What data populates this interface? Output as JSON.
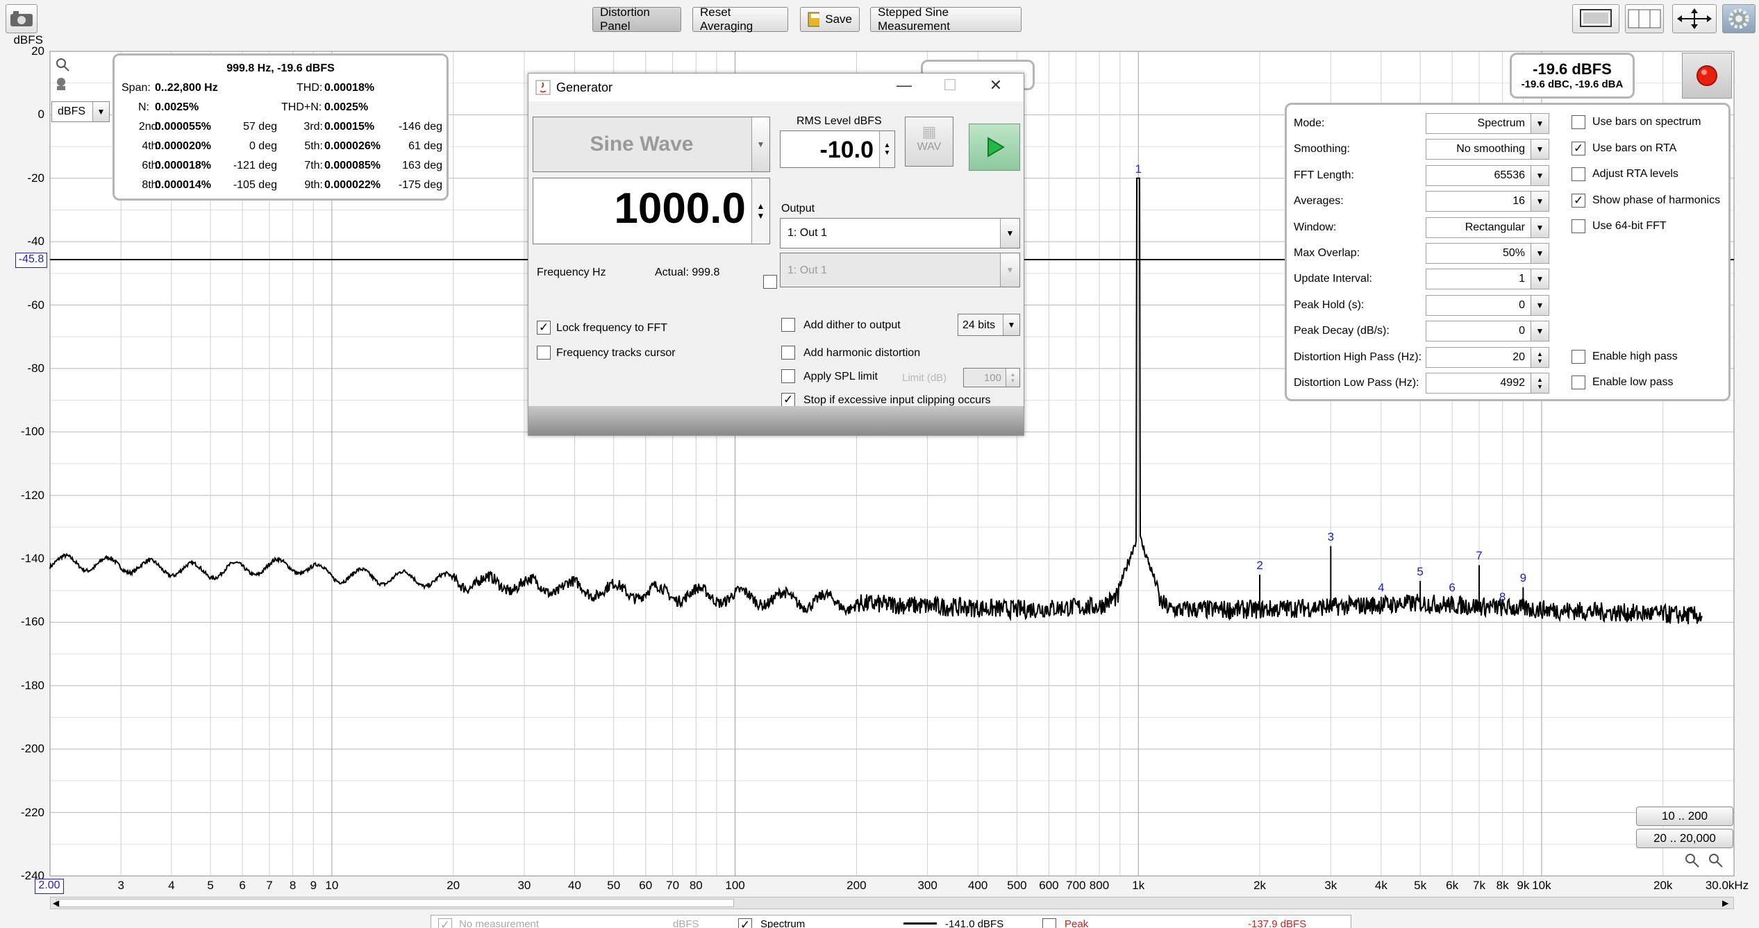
{
  "toolbar": {
    "distortion_panel": "Distortion Panel",
    "reset_averaging": "Reset Averaging",
    "save": "Save",
    "stepped_sine": "Stepped Sine Measurement"
  },
  "plot": {
    "y_unit": "dBFS",
    "y_ticks": [
      "20",
      "0",
      "-20",
      "-40",
      "-60",
      "-80",
      "-100",
      "-120",
      "-140",
      "-160",
      "-180",
      "-200",
      "-220",
      "-240"
    ],
    "x_ticks": [
      "2.00",
      "3",
      "4",
      "5",
      "6",
      "7",
      "8",
      "9",
      "10",
      "20",
      "30",
      "40",
      "50",
      "60",
      "70",
      "80",
      "100",
      "200",
      "300",
      "400",
      "500",
      "600",
      "700",
      "800",
      "1k",
      "2k",
      "3k",
      "4k",
      "5k",
      "6k",
      "7k",
      "8k",
      "9k",
      "10k",
      "20k",
      "30.0kHz"
    ],
    "cursor_level": "-45.8",
    "unit_select": "dBFS",
    "harmonic_labels": [
      "1",
      "2",
      "3",
      "4",
      "5",
      "6",
      "7",
      "8",
      "9"
    ]
  },
  "chart_data": {
    "type": "line",
    "title": "",
    "xlabel": "",
    "ylabel": "dBFS",
    "xscale": "log",
    "xlim": [
      2,
      30000
    ],
    "ylim": [
      -240,
      20
    ],
    "grid": true,
    "series": [
      {
        "name": "Spectrum",
        "x": [
          2,
          3,
          5,
          8,
          10,
          20,
          50,
          100,
          200,
          500,
          800,
          950,
          1000,
          1050,
          1200,
          2000,
          5000,
          10000,
          25000
        ],
        "y": [
          -141,
          -142,
          -144,
          -142,
          -145,
          -147,
          -150,
          -152,
          -154,
          -156,
          -155,
          -150,
          -20,
          -150,
          -156,
          -156,
          -154,
          -156,
          -158
        ]
      }
    ],
    "peaks": [
      {
        "label": "1",
        "x": 1000,
        "y": -20
      },
      {
        "label": "2",
        "x": 2000,
        "y": -145
      },
      {
        "label": "3",
        "x": 3000,
        "y": -136
      },
      {
        "label": "4",
        "x": 4000,
        "y": -152
      },
      {
        "label": "5",
        "x": 5000,
        "y": -147
      },
      {
        "label": "6",
        "x": 6000,
        "y": -152
      },
      {
        "label": "7",
        "x": 7000,
        "y": -142
      },
      {
        "label": "8",
        "x": 8000,
        "y": -155
      },
      {
        "label": "9",
        "x": 9000,
        "y": -149
      }
    ]
  },
  "distortion": {
    "header": "999.8 Hz, -19.6 dBFS",
    "span_label": "Span:",
    "span_value": "0..22,800 Hz",
    "thd_label": "THD:",
    "thd_value": "0.00018%",
    "n_label": "N:",
    "n_value": "0.0025%",
    "thdn_label": "THD+N:",
    "thdn_value": "0.0025%",
    "harmonics": [
      {
        "l1": "2nd:",
        "v1": "0.000055%",
        "p1": "57 deg",
        "l2": "3rd:",
        "v2": "0.00015%",
        "p2": "-146 deg"
      },
      {
        "l1": "4th:",
        "v1": "0.000020%",
        "p1": "0 deg",
        "l2": "5th:",
        "v2": "0.000026%",
        "p2": "61 deg"
      },
      {
        "l1": "6th:",
        "v1": "0.000018%",
        "p1": "-121 deg",
        "l2": "7th:",
        "v2": "0.000085%",
        "p2": "163 deg"
      },
      {
        "l1": "8th:",
        "v1": "0.000014%",
        "p1": "-105 deg",
        "l2": "9th:",
        "v2": "0.000022%",
        "p2": "-175 deg"
      }
    ]
  },
  "level_box": {
    "main": "-19.6 dBFS",
    "sub": "-19.6 dBC, -19.6 dBA"
  },
  "generator": {
    "title": "Generator",
    "signal_type": "Sine Wave",
    "rms_label": "RMS Level dBFS",
    "rms_value": "-10.0",
    "wav_label": "WAV",
    "frequency": "1000.0",
    "freq_label": "Frequency Hz",
    "actual": "Actual: 999.8",
    "output_label": "Output",
    "output_1": "1: Out 1",
    "output_2": "1: Out 1",
    "lock_freq": "Lock frequency to FFT",
    "freq_tracks": "Frequency tracks cursor",
    "add_dither": "Add dither to output",
    "bits": "24 bits",
    "add_harm": "Add harmonic distortion",
    "apply_spl": "Apply SPL limit",
    "limit_label": "Limit (dB)",
    "limit_value": "100",
    "stop_clip": "Stop if excessive input clipping occurs"
  },
  "settings": {
    "rows": [
      {
        "label": "Mode:",
        "value": "Spectrum"
      },
      {
        "label": "Smoothing:",
        "value": "No  smoothing"
      },
      {
        "label": "FFT Length:",
        "value": "65536"
      },
      {
        "label": "Averages:",
        "value": "16"
      },
      {
        "label": "Window:",
        "value": "Rectangular"
      },
      {
        "label": "Max Overlap:",
        "value": "50%"
      },
      {
        "label": "Update Interval:",
        "value": "1"
      },
      {
        "label": "Peak Hold (s):",
        "value": "0"
      },
      {
        "label": "Peak Decay (dB/s):",
        "value": "0"
      },
      {
        "label": "Distortion High Pass (Hz):",
        "value": "20"
      },
      {
        "label": "Distortion Low Pass (Hz):",
        "value": "4992"
      }
    ],
    "options": [
      {
        "label": "Use bars on spectrum",
        "checked": false
      },
      {
        "label": "Use bars on RTA",
        "checked": true
      },
      {
        "label": "Adjust RTA levels",
        "checked": false
      },
      {
        "label": "Show phase of harmonics",
        "checked": true
      },
      {
        "label": "Use 64-bit FFT",
        "checked": false
      },
      {
        "label": "Enable high pass",
        "checked": false
      },
      {
        "label": "Enable low pass",
        "checked": false
      }
    ]
  },
  "range_buttons": [
    "10 .. 200",
    "20 .. 20,000"
  ],
  "legend": {
    "no_measurement": "No measurement",
    "dbfs1": "dBFS",
    "spectrum": "Spectrum",
    "spectrum_level": "-141.0 dBFS",
    "peak": "Peak",
    "peak_level": "-137.9 dBFS"
  }
}
